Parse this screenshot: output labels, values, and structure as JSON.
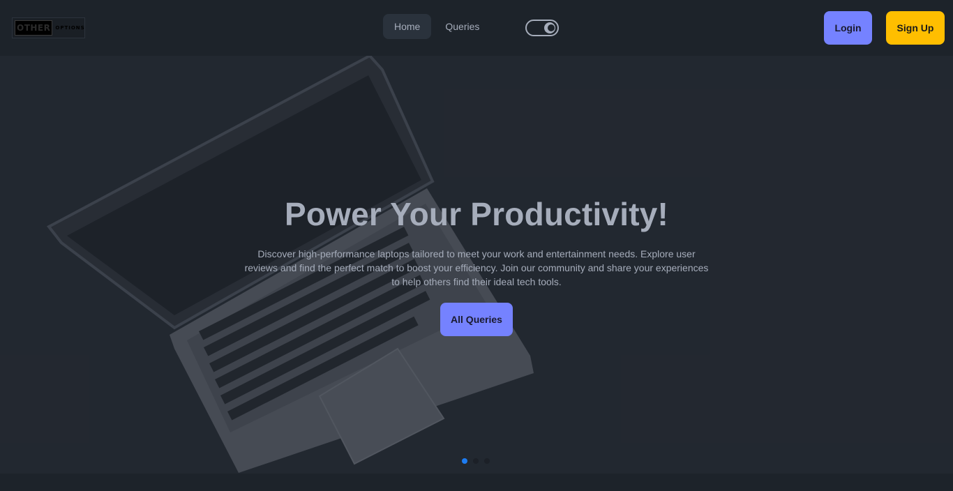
{
  "logo": {
    "word1": "OTHER",
    "word2": "OPTIONS"
  },
  "nav": {
    "links": [
      {
        "label": "Home",
        "active": true
      },
      {
        "label": "Queries",
        "active": false
      }
    ],
    "theme_toggle_icon": "moon-icon",
    "login_label": "Login",
    "signup_label": "Sign Up"
  },
  "hero": {
    "title": "Power Your Productivity!",
    "description": "Discover high-performance laptops tailored to meet your work and entertainment needs. Explore user reviews and find the perfect match to boost your efficiency. Join our community and share your experiences to help others find their ideal tech tools.",
    "cta_label": "All Queries",
    "slides_count": 3,
    "active_slide": 1
  },
  "colors": {
    "background": "#1d232a",
    "primary": "#7582ff",
    "warning": "#ffbe00",
    "text": "#a6adbb",
    "dot_active": "#1d7cf2"
  }
}
